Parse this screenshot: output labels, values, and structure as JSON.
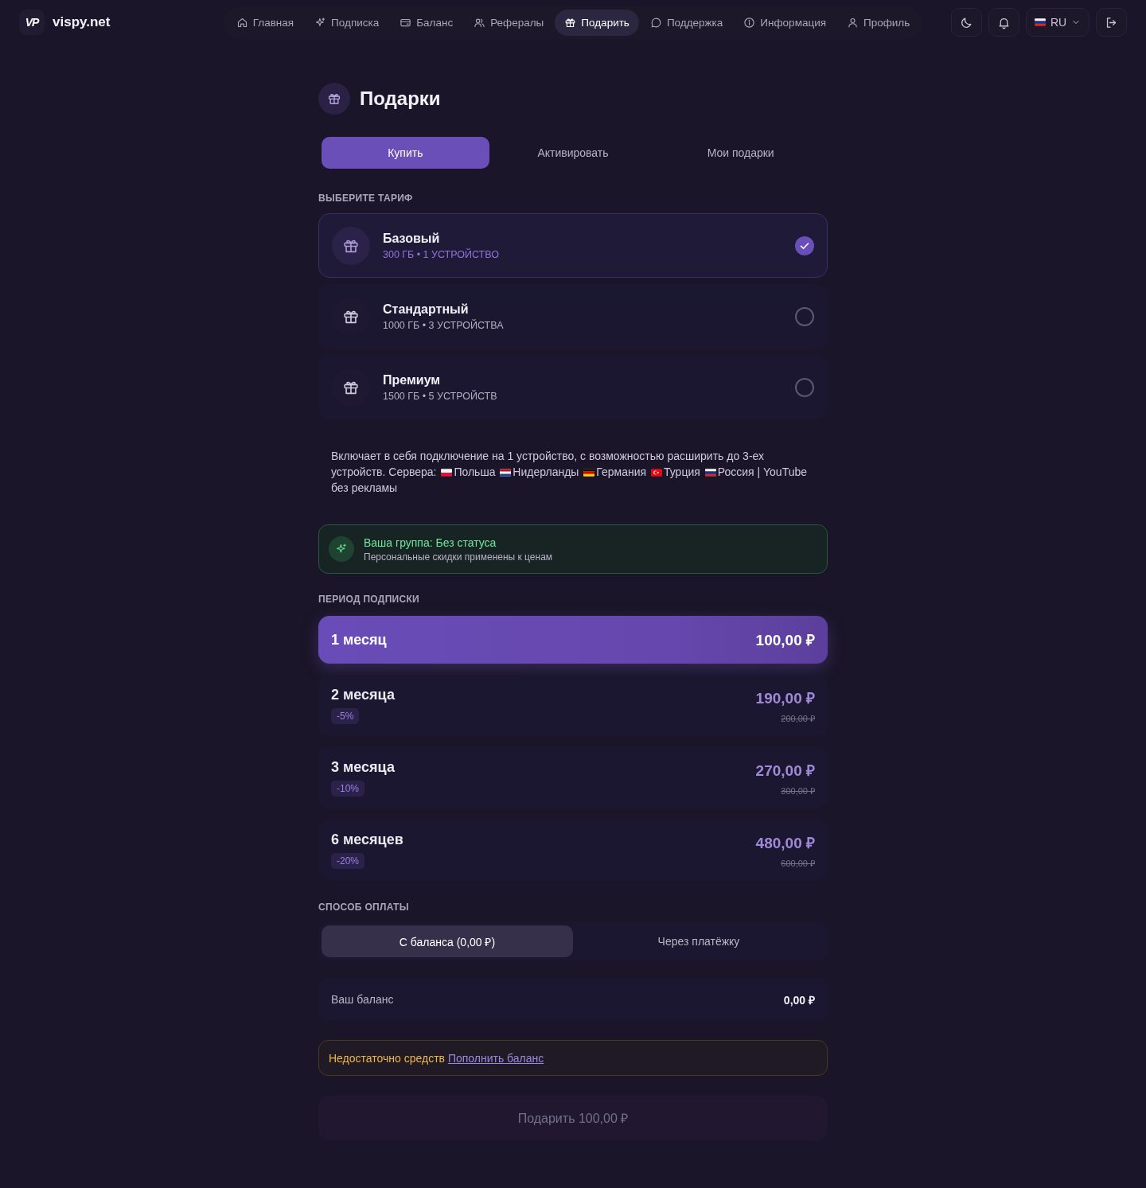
{
  "header": {
    "logo": {
      "mark": "VP",
      "name": "vispy.net"
    },
    "nav": [
      {
        "label": "Главная",
        "selected": false
      },
      {
        "label": "Подписка",
        "selected": false
      },
      {
        "label": "Баланс",
        "selected": false
      },
      {
        "label": "Рефералы",
        "selected": false
      },
      {
        "label": "Подарить",
        "selected": true
      },
      {
        "label": "Поддержка",
        "selected": false
      },
      {
        "label": "Информация",
        "selected": false
      },
      {
        "label": "Профиль",
        "selected": false
      }
    ],
    "language": {
      "label": "RU"
    }
  },
  "page": {
    "title": "Подарки"
  },
  "tabs": [
    {
      "label": "Купить",
      "selected": true
    },
    {
      "label": "Активировать",
      "selected": false
    },
    {
      "label": "Мои подарки",
      "selected": false
    }
  ],
  "plans": {
    "heading": "ВЫБЕРИТЕ ТАРИФ",
    "items": [
      {
        "name": "Базовый",
        "details": "300 ГБ • 1 УСТРОЙСТВО",
        "selected": true
      },
      {
        "name": "Стандартный",
        "details": "1000 ГБ • 3 УСТРОЙСТВА",
        "selected": false
      },
      {
        "name": "Премиум",
        "details": "1500 ГБ • 5 УСТРОЙСТВ",
        "selected": false
      }
    ]
  },
  "description": {
    "text": "Включает в себя подключение на 1 устройство, с возможностью расширить до 3-ех устройств. Сервера:",
    "servers": [
      "Польша",
      "Нидерланды",
      "Германия",
      "Турция",
      "Россия | YouTube без рекламы"
    ]
  },
  "group_notice": {
    "title": "Ваша группа: Без статуса",
    "subtitle": "Персональные скидки применены к ценам"
  },
  "periods": {
    "heading": "ПЕРИОД ПОДПИСКИ",
    "items": [
      {
        "name": "1 месяц",
        "price": "100,00 ₽",
        "selected": true
      },
      {
        "name": "2 месяца",
        "discount": "-5%",
        "price": "190,00 ₽",
        "old_price": "200,00 ₽",
        "selected": false
      },
      {
        "name": "3 месяца",
        "discount": "-10%",
        "price": "270,00 ₽",
        "old_price": "300,00 ₽",
        "selected": false
      },
      {
        "name": "6 месяцев",
        "discount": "-20%",
        "price": "480,00 ₽",
        "old_price": "600,00 ₽",
        "selected": false
      }
    ]
  },
  "payment": {
    "heading": "СПОСОБ ОПЛАТЫ",
    "methods": [
      {
        "label": "С баланса (0,00 ₽)",
        "selected": true
      },
      {
        "label": "Через платёжку",
        "selected": false
      }
    ],
    "balance_label": "Ваш баланс",
    "balance_value": "0,00 ₽"
  },
  "warning": {
    "text": "Недостаточно средств",
    "link": "Пополнить баланс"
  },
  "submit": {
    "label": "Подарить 100,00 ₽",
    "disabled": true
  }
}
